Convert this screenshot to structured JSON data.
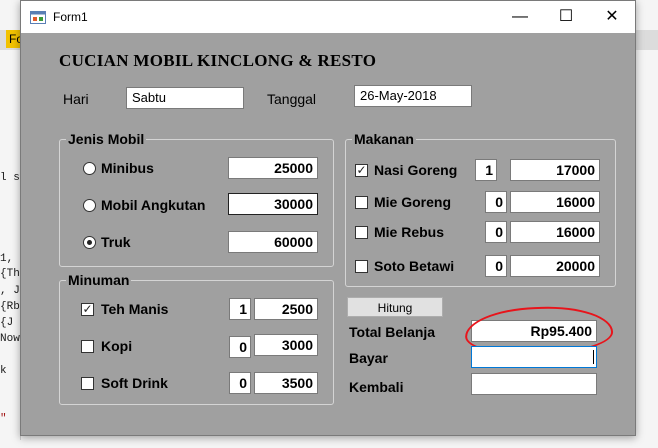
{
  "ide": {
    "tab_label": "Fo",
    "code_lines": [
      "l s",
      "1,",
      "{Th",
      ", J",
      "{Rb",
      " {J",
      "Now",
      "k",
      "\""
    ]
  },
  "window": {
    "title": "Form1",
    "minimize_glyph": "—",
    "maximize_glyph": "☐",
    "close_glyph": "✕"
  },
  "form": {
    "heading": "CUCIAN MOBIL KINCLONG & RESTO",
    "hari_label": "Hari",
    "hari_value": "Sabtu",
    "tanggal_label": "Tanggal",
    "tanggal_value": "26-May-2018"
  },
  "jenis_mobil": {
    "title": "Jenis Mobil",
    "items": [
      {
        "label": "Minibus",
        "price": "25000",
        "selected": false
      },
      {
        "label": "Mobil Angkutan",
        "price": "30000",
        "selected": false
      },
      {
        "label": "Truk",
        "price": "60000",
        "selected": true
      }
    ]
  },
  "minuman": {
    "title": "Minuman",
    "items": [
      {
        "label": "Teh Manis",
        "qty": "1",
        "price": "2500",
        "checked": true,
        "check_mark": "✓"
      },
      {
        "label": "Kopi",
        "qty": "0",
        "price": "3000",
        "checked": false,
        "check_mark": ""
      },
      {
        "label": "Soft Drink",
        "qty": "0",
        "price": "3500",
        "checked": false,
        "check_mark": ""
      }
    ]
  },
  "makanan": {
    "title": "Makanan",
    "items": [
      {
        "label": "Nasi Goreng",
        "qty": "1",
        "price": "17000",
        "checked": true,
        "check_mark": "✓"
      },
      {
        "label": "Mie Goreng",
        "qty": "0",
        "price": "16000",
        "checked": false,
        "check_mark": ""
      },
      {
        "label": "Mie Rebus",
        "qty": "0",
        "price": "16000",
        "checked": false,
        "check_mark": ""
      },
      {
        "label": "Soto Betawi",
        "qty": "0",
        "price": "20000",
        "checked": false,
        "check_mark": ""
      }
    ]
  },
  "totals": {
    "hitung_label": "Hitung",
    "total_label": "Total Belanja",
    "total_value": "Rp95.400",
    "bayar_label": "Bayar",
    "bayar_value": "",
    "kembali_label": "Kembali",
    "kembali_value": ""
  },
  "colors": {
    "form_bg": "#a0a0a0",
    "annotation": "#e8141b",
    "focus": "#0078d7"
  }
}
